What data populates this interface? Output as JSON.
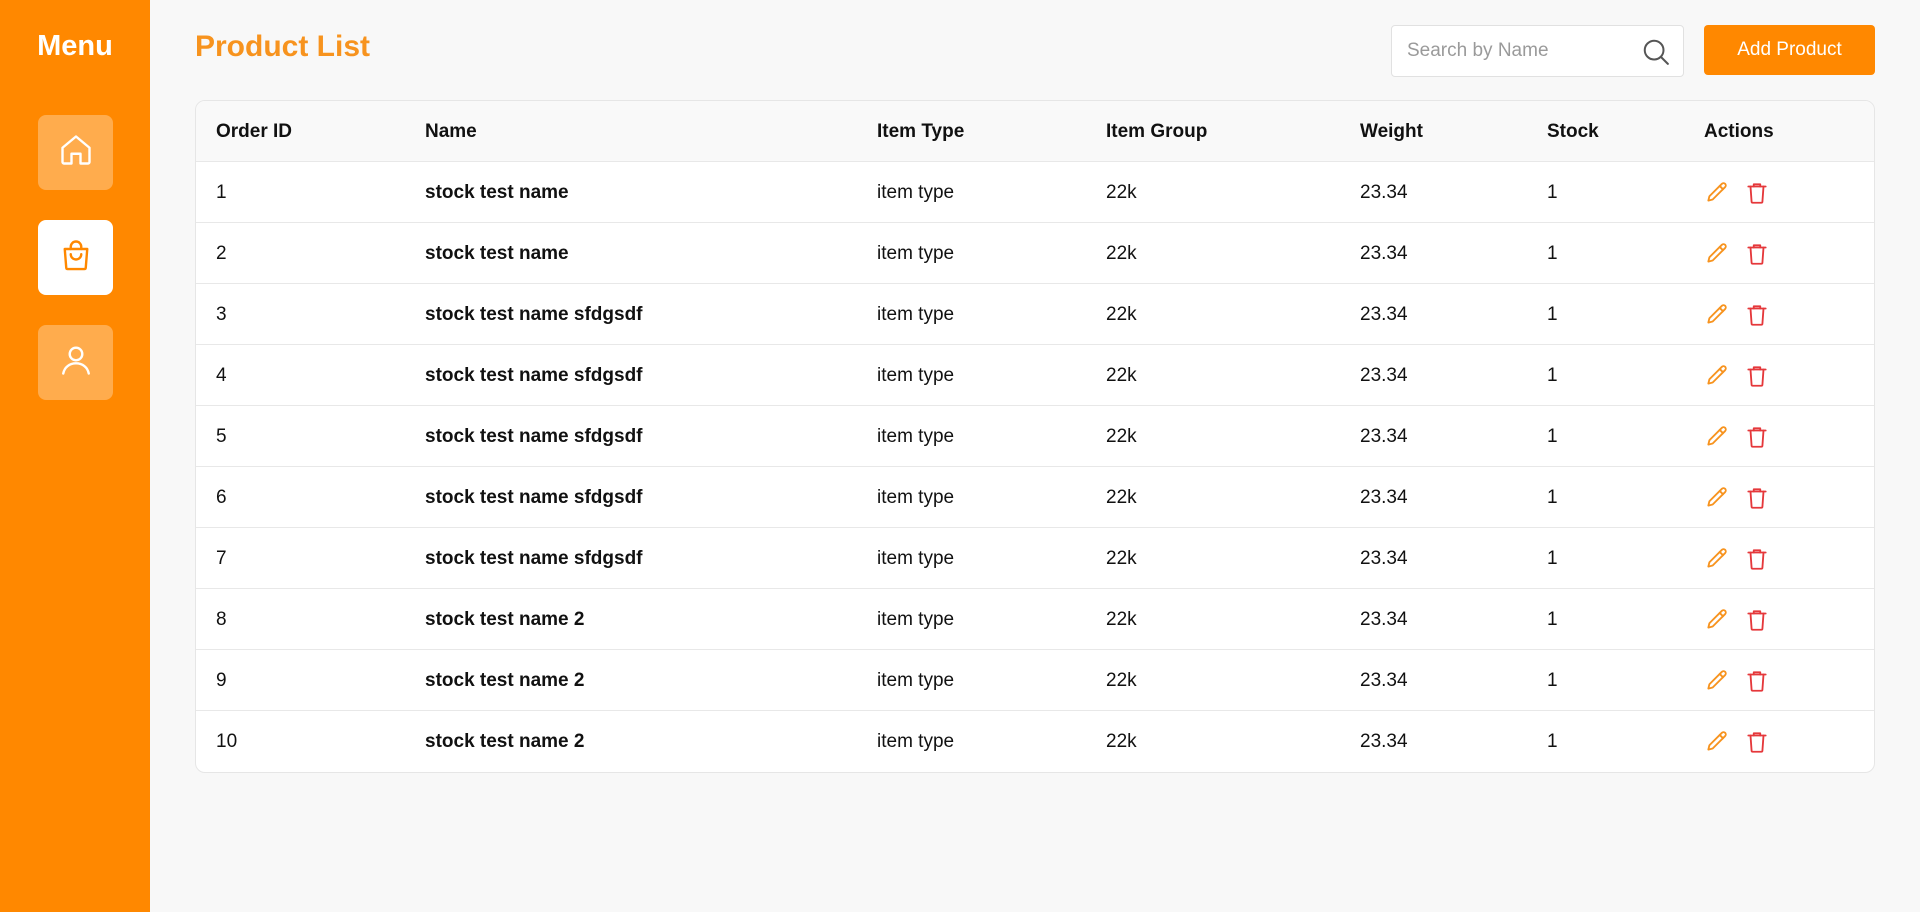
{
  "sidebar": {
    "title": "Menu",
    "items": [
      {
        "icon": "home-icon",
        "active": false
      },
      {
        "icon": "shopping-bag-icon",
        "active": true
      },
      {
        "icon": "user-icon",
        "active": false
      }
    ]
  },
  "header": {
    "title": "Product List",
    "search_placeholder": "Search by Name",
    "search_value": "",
    "add_button_label": "Add Product"
  },
  "table": {
    "columns": [
      "Order ID",
      "Name",
      "Item Type",
      "Item Group",
      "Weight",
      "Stock",
      "Actions"
    ],
    "rows": [
      {
        "id": "1",
        "name": "stock test name",
        "type": "item type",
        "group": "22k",
        "weight": "23.34",
        "stock": "1"
      },
      {
        "id": "2",
        "name": "stock test name",
        "type": "item type",
        "group": "22k",
        "weight": "23.34",
        "stock": "1"
      },
      {
        "id": "3",
        "name": "stock test name sfdgsdf",
        "type": "item type",
        "group": "22k",
        "weight": "23.34",
        "stock": "1"
      },
      {
        "id": "4",
        "name": "stock test name sfdgsdf",
        "type": "item type",
        "group": "22k",
        "weight": "23.34",
        "stock": "1"
      },
      {
        "id": "5",
        "name": "stock test name sfdgsdf",
        "type": "item type",
        "group": "22k",
        "weight": "23.34",
        "stock": "1"
      },
      {
        "id": "6",
        "name": "stock test name sfdgsdf",
        "type": "item type",
        "group": "22k",
        "weight": "23.34",
        "stock": "1"
      },
      {
        "id": "7",
        "name": "stock test name sfdgsdf",
        "type": "item type",
        "group": "22k",
        "weight": "23.34",
        "stock": "1"
      },
      {
        "id": "8",
        "name": "stock test name 2",
        "type": "item type",
        "group": "22k",
        "weight": "23.34",
        "stock": "1"
      },
      {
        "id": "9",
        "name": "stock test name 2",
        "type": "item type",
        "group": "22k",
        "weight": "23.34",
        "stock": "1"
      },
      {
        "id": "10",
        "name": "stock test name 2",
        "type": "item type",
        "group": "22k",
        "weight": "23.34",
        "stock": "1"
      }
    ]
  },
  "colors": {
    "brand": "#ff8800",
    "title": "#f7931e",
    "edit": "#f7931e",
    "delete": "#e5383b"
  }
}
